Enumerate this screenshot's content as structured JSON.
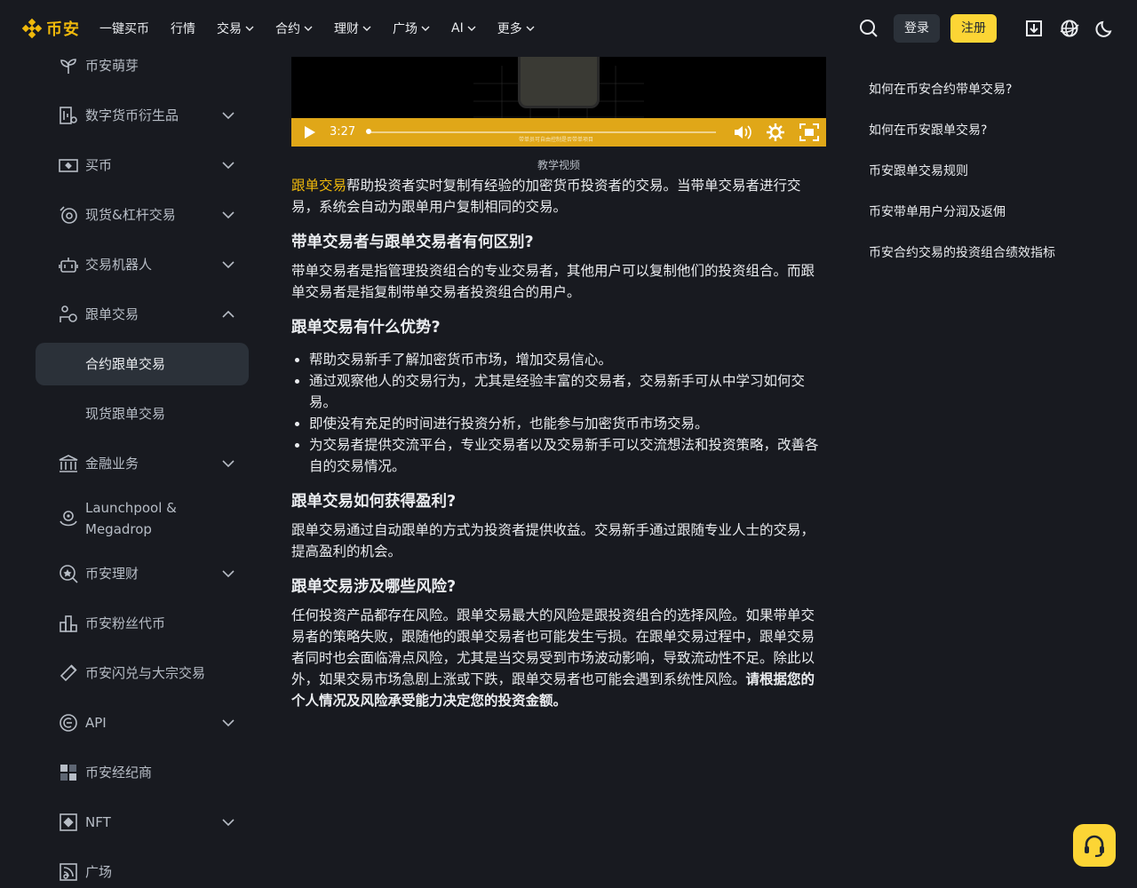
{
  "header": {
    "logo_text": "币安",
    "nav": [
      {
        "label": "一键买币",
        "has_menu": false
      },
      {
        "label": "行情",
        "has_menu": false
      },
      {
        "label": "交易",
        "has_menu": true
      },
      {
        "label": "合约",
        "has_menu": true
      },
      {
        "label": "理财",
        "has_menu": true
      },
      {
        "label": "广场",
        "has_menu": true
      },
      {
        "label": "AI",
        "has_menu": true
      },
      {
        "label": "更多",
        "has_menu": true
      }
    ],
    "login_label": "登录",
    "register_label": "注册"
  },
  "sidebar": {
    "items": [
      {
        "label": "币安萌芽",
        "icon": "sprout-icon",
        "has_chevron": false
      },
      {
        "label": "数字货币衍生品",
        "icon": "derivatives-icon",
        "has_chevron": true
      },
      {
        "label": "买币",
        "icon": "buy-crypto-icon",
        "has_chevron": true
      },
      {
        "label": "现货&杠杆交易",
        "icon": "spot-margin-icon",
        "has_chevron": true
      },
      {
        "label": "交易机器人",
        "icon": "trading-bot-icon",
        "has_chevron": true
      },
      {
        "label": "跟单交易",
        "icon": "copy-trading-icon",
        "has_chevron": true,
        "expanded": true
      },
      {
        "label": "合约跟单交易",
        "sub": true,
        "active": true
      },
      {
        "label": "现货跟单交易",
        "sub": true
      },
      {
        "label": "金融业务",
        "icon": "bank-icon",
        "has_chevron": true
      },
      {
        "label": "Launchpool & Megadrop",
        "icon": "launchpool-icon",
        "has_chevron": false
      },
      {
        "label": "币安理财",
        "icon": "earn-icon",
        "has_chevron": true
      },
      {
        "label": "币安粉丝代币",
        "icon": "fan-token-icon",
        "has_chevron": false
      },
      {
        "label": "币安闪兑与大宗交易",
        "icon": "convert-icon",
        "has_chevron": false
      },
      {
        "label": "API",
        "icon": "api-icon",
        "has_chevron": true
      },
      {
        "label": "币安经纪商",
        "icon": "broker-icon",
        "has_chevron": false
      },
      {
        "label": "NFT",
        "icon": "nft-icon",
        "has_chevron": true
      },
      {
        "label": "广场",
        "icon": "square-feed-icon",
        "has_chevron": false
      }
    ]
  },
  "video": {
    "time": "3:27",
    "subtitle": "带单员可自由控制是否带单项目",
    "progress": 0.0,
    "caption": "教学视频"
  },
  "article": {
    "intro_link": "跟单交易",
    "intro_text": "帮助投资者实时复制有经验的加密货币投资者的交易。当带单交易者进行交易，系统会自动为跟单用户复制相同的交易。",
    "h1": "带单交易者与跟单交易者有何区别?",
    "p1": "带单交易者是指管理投资组合的专业交易者，其他用户可以复制他们的投资组合。而跟单交易者是指复制带单交易者投资组合的用户。",
    "h2": "跟单交易有什么优势?",
    "bullets": [
      "帮助交易新手了解加密货币市场，增加交易信心。",
      "通过观察他人的交易行为，尤其是经验丰富的交易者，交易新手可从中学习如何交易。",
      "即使没有充足的时间进行投资分析，也能参与加密货币市场交易。",
      "为交易者提供交流平台，专业交易者以及交易新手可以交流想法和投资策略，改善各自的交易情况。"
    ],
    "h3": "跟单交易如何获得盈利?",
    "p3": "跟单交易通过自动跟单的方式为投资者提供收益。交易新手通过跟随专业人士的交易，提高盈利的机会。",
    "h4": "跟单交易涉及哪些风险?",
    "p4": "任何投资产品都存在风险。跟单交易最大的风险是跟投资组合的选择风险。如果带单交易者的策略失败，跟随他的跟单交易者也可能发生亏损。在跟单交易过程中，跟单交易者同时也会面临滑点风险，尤其是当交易受到市场波动影响，导致流动性不足。除此以外，如果交易市场急剧上涨或下跌，跟单交易者也可能会遇到系统性风险。",
    "p4_bold": "请根据您的个人情况及风险承受能力决定您的投资金额。"
  },
  "toc": [
    "如何在币安合约带单交易?",
    "如何在币安跟单交易?",
    "币安跟单交易规则",
    "币安带单用户分润及返佣",
    "币安合约交易的投资组合绩效指标"
  ],
  "colors": {
    "accent": "#f0b90b",
    "button_yellow": "#fcd535",
    "background": "#181a20",
    "panel": "#2b3139"
  }
}
